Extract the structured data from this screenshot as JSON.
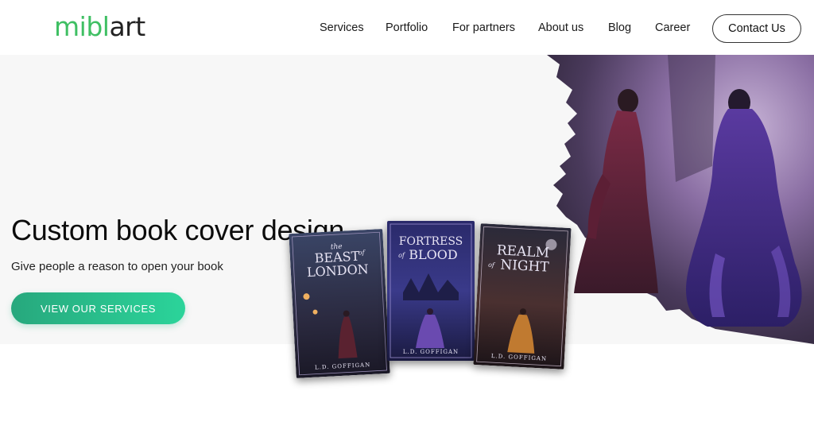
{
  "brand": {
    "logo_part1": "mibl",
    "logo_part2": "art"
  },
  "nav": {
    "items": [
      "Services",
      "Portfolio",
      "For partners",
      "About us",
      "Blog",
      "Career"
    ],
    "contact_label": "Contact Us"
  },
  "hero": {
    "headline": "Custom book cover design",
    "subhead": "Give people a reason to open your book",
    "cta_label": "VIEW OUR SERVICES"
  },
  "books": [
    {
      "title_line1": "BEAST",
      "title_line2": "LONDON",
      "small_prefix": "the",
      "small_mid": "of",
      "author": "L.D. GOFFIGAN"
    },
    {
      "title_line1": "FORTRESS",
      "title_line2": "BLOOD",
      "small_mid": "of",
      "author": "L.D. GOFFIGAN"
    },
    {
      "title_line1": "REALM",
      "title_line2": "NIGHT",
      "small_mid": "of",
      "author": "L.D. GOFFIGAN"
    }
  ],
  "colors": {
    "brand_green": "#3fbf63",
    "cta_start": "#27a87d",
    "cta_end": "#2bd49a",
    "hero_bg": "#f7f7f7"
  }
}
